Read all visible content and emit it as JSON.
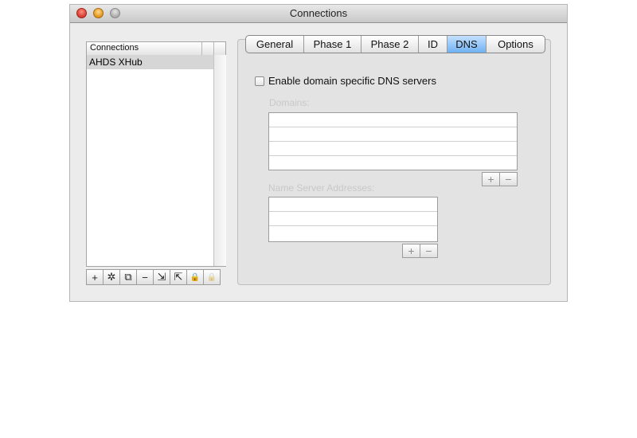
{
  "window": {
    "title": "Connections"
  },
  "sidebar": {
    "header": "Connections",
    "items": [
      {
        "label": "AHDS XHub",
        "selected": true
      }
    ],
    "toolbar": [
      {
        "icon": "add-icon",
        "glyph": "+",
        "enabled": true
      },
      {
        "icon": "wizard-icon",
        "glyph": "✲",
        "enabled": true
      },
      {
        "icon": "duplicate-icon",
        "glyph": "⧉",
        "enabled": true
      },
      {
        "icon": "remove-icon",
        "glyph": "−",
        "enabled": true
      },
      {
        "icon": "import-icon",
        "glyph": "⇲",
        "enabled": true
      },
      {
        "icon": "export-icon",
        "glyph": "⇱",
        "enabled": true
      },
      {
        "icon": "lock-icon",
        "glyph": "🔒",
        "enabled": true
      },
      {
        "icon": "lock-disabled-icon",
        "glyph": "🔒",
        "enabled": false
      }
    ]
  },
  "tabs": [
    {
      "label": "General"
    },
    {
      "label": "Phase 1"
    },
    {
      "label": "Phase 2"
    },
    {
      "label": "ID"
    },
    {
      "label": "DNS",
      "selected": true
    },
    {
      "label": "Options"
    }
  ],
  "dns": {
    "enable_label": "Enable domain specific DNS servers",
    "enabled": false,
    "domains_label": "Domains:",
    "name_servers_label": "Name Server Addresses:",
    "add_glyph": "+",
    "remove_glyph": "−"
  },
  "colors": {
    "selected_tab": "#6fb1f2",
    "selected_row": "#d6d6d6",
    "disabled_text": "#c8c8c8"
  }
}
